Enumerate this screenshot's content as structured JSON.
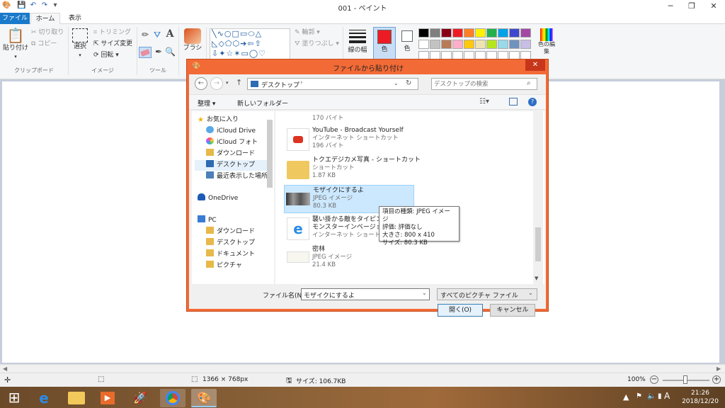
{
  "window": {
    "title": "001 - ペイント",
    "minimize": "─",
    "maximize": "❐",
    "close": "✕"
  },
  "tabs": {
    "file": "ファイル",
    "home": "ホーム",
    "view": "表示"
  },
  "ribbon": {
    "paste": "貼り付け",
    "cut": "切り取り",
    "copy": "コピー",
    "select": "選択",
    "crop": "トリミング",
    "resize": "サイズ変更",
    "rotate": "回転",
    "brushes": "ブラシ",
    "outline": "輪郭",
    "fill": "塗りつぶし",
    "size": "線の幅",
    "color1": "色",
    "color2": "色",
    "edit_colors": "色の編集",
    "groups": {
      "clipboard": "クリップボード",
      "image": "イメージ",
      "tools": "ツール"
    },
    "palette_row1": [
      "#000000",
      "#7f7f7f",
      "#880015",
      "#ed1c24",
      "#ff7f27",
      "#fff200",
      "#22b14c",
      "#00a2e8",
      "#3f48cc",
      "#a349a4"
    ],
    "palette_row2": [
      "#ffffff",
      "#c3c3c3",
      "#b97a57",
      "#ffaec9",
      "#ffc90e",
      "#efe4b0",
      "#b5e61d",
      "#99d9ea",
      "#7092be",
      "#c8bfe7"
    ],
    "color1_value": "#ed1c24",
    "color2_value": "#ffffff"
  },
  "dialog": {
    "title": "ファイルから貼り付け",
    "close": "✕",
    "path": "デスクトップ",
    "search_placeholder": "デスクトップの検索",
    "organize": "整理 ▾",
    "new_folder": "新しいフォルダー",
    "help": "?",
    "tree": [
      {
        "label": "お気に入り",
        "icon": "star-icon"
      },
      {
        "label": "iCloud Drive",
        "icon": "cloud-icon"
      },
      {
        "label": "iCloud フォト",
        "icon": "photos-icon"
      },
      {
        "label": "ダウンロード",
        "icon": "download-folder-icon"
      },
      {
        "label": "デスクトップ",
        "icon": "desktop-icon"
      },
      {
        "label": "最近表示した場所",
        "icon": "recent-icon"
      },
      {
        "label": "OneDrive",
        "icon": "onedrive-icon"
      },
      {
        "label": "PC",
        "icon": "pc-icon"
      },
      {
        "label": "ダウンロード",
        "icon": "download-folder-icon"
      },
      {
        "label": "デスクトップ",
        "icon": "desktop-icon"
      },
      {
        "label": "ドキュメント",
        "icon": "documents-icon"
      },
      {
        "label": "ピクチャ",
        "icon": "pictures-icon"
      }
    ],
    "files": [
      {
        "name": "",
        "type": "",
        "size": "170 バイト"
      },
      {
        "name": "YouTube - Broadcast Yourself",
        "type": "インターネット ショートカット",
        "size": "196 バイト"
      },
      {
        "name": "トクエデジカメ写真 - ショートカット",
        "type": "ショートカット",
        "size": "1.87 KB"
      },
      {
        "name": "モザイクにするよ",
        "type": "JPEG イメージ",
        "size": "80.3 KB"
      },
      {
        "name": "襲い掛かる敵をタイピングで",
        "name2": "モンスターインベージョン 無",
        "type": "インターネット ショートカット",
        "size": ""
      },
      {
        "name": "密林",
        "type": "JPEG イメージ",
        "size": "21.4 KB"
      }
    ],
    "tooltip": [
      "項目の種類: JPEG イメージ",
      "評価: 評価なし",
      "大きさ: 800 x 410",
      "サイズ: 80.3 KB"
    ],
    "filename_label": "ファイル名(N):",
    "filename_value": "モザイクにするよ",
    "filter_value": "すべてのピクチャ ファイル",
    "open_button": "開く(O)",
    "cancel_button": "キャンセル"
  },
  "status": {
    "dimensions": "1366 × 768px",
    "filesize": "サイズ: 106.7KB",
    "zoom": "100%"
  },
  "taskbar": {
    "time": "21:26",
    "date": "2018/12/20",
    "ime": "A"
  }
}
